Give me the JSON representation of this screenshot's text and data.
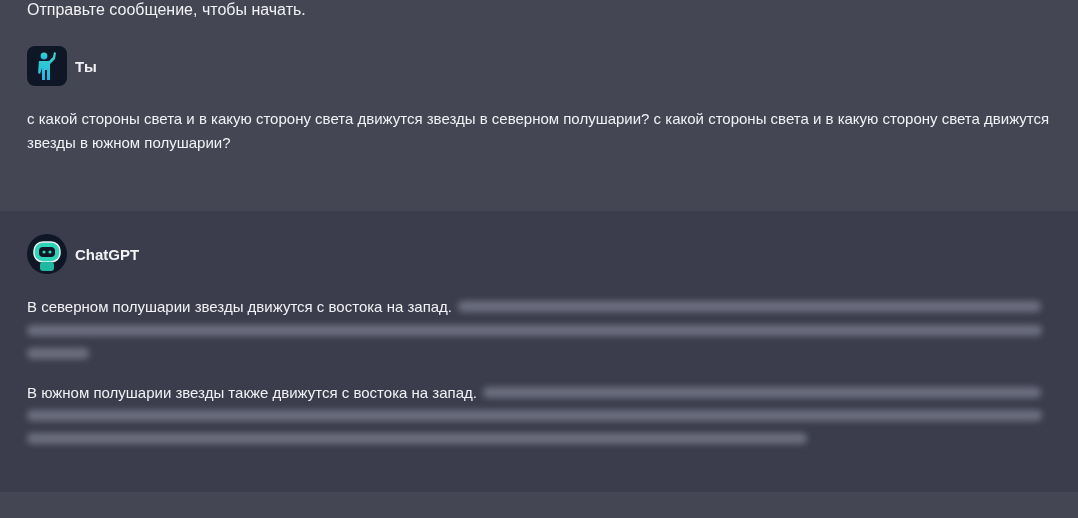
{
  "intro": "Отправьте сообщение, чтобы начать.",
  "messages": [
    {
      "kind": "user",
      "author": "Ты",
      "paragraphs": [
        {
          "text": "с какой стороны света и в какую сторону света движутся звезды в северном полушарии? с какой стороны света и в какую сторону света движутся звезды в южном полушарии?",
          "blurred": false
        }
      ]
    },
    {
      "kind": "bot",
      "author": "ChatGPT",
      "paragraphs": [
        {
          "text": "В северном полушарии звезды движутся с востока на запад.",
          "blurred": true
        },
        {
          "text": "В южном полушарии звезды также движутся с востока на запад.",
          "blurred": true
        }
      ]
    }
  ]
}
